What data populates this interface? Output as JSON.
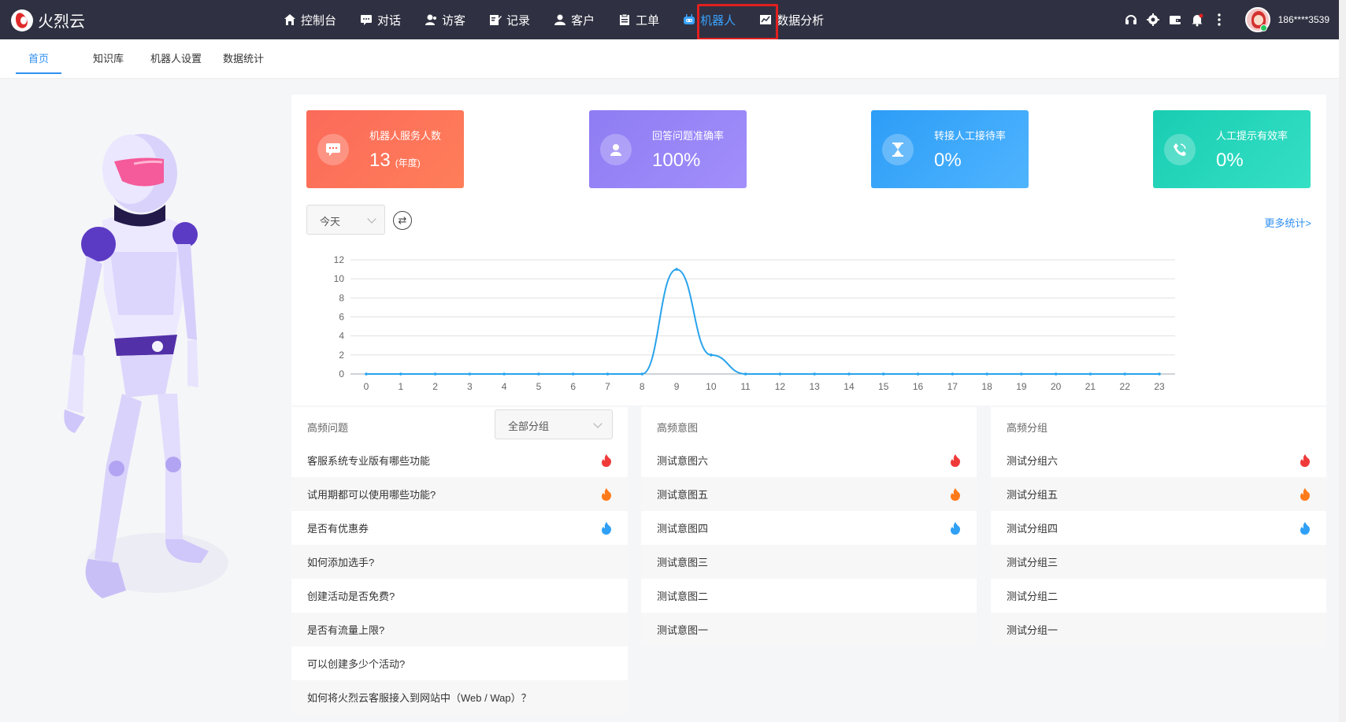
{
  "app": {
    "name": "火烈云"
  },
  "nav": {
    "items": [
      {
        "label": "控制台",
        "icon": "home-icon"
      },
      {
        "label": "对话",
        "icon": "chat-icon"
      },
      {
        "label": "访客",
        "icon": "visitor-icon"
      },
      {
        "label": "记录",
        "icon": "record-icon"
      },
      {
        "label": "客户",
        "icon": "customer-icon"
      },
      {
        "label": "工单",
        "icon": "ticket-icon"
      },
      {
        "label": "机器人",
        "icon": "robot-icon",
        "active": true
      },
      {
        "label": "数据分析",
        "icon": "analytics-icon"
      }
    ]
  },
  "user": {
    "name": "186****3539"
  },
  "subnav": {
    "items": [
      "首页",
      "知识库",
      "机器人设置",
      "数据统计"
    ]
  },
  "cards": [
    {
      "title": "机器人服务人数",
      "value": "13",
      "suffix": "(年度)",
      "color": "#fb6a5a"
    },
    {
      "title": "回答问题准确率",
      "value": "100%",
      "color": "#9584f6"
    },
    {
      "title": "转接人工接待率",
      "value": "0%",
      "color": "#3aa6fa"
    },
    {
      "title": "人工提示有效率",
      "value": "0%",
      "color": "#21d3b9"
    }
  ],
  "filters": {
    "period": "今天",
    "group": "全部分组",
    "more": "更多统计>"
  },
  "chart_data": {
    "type": "line",
    "x": [
      0,
      1,
      2,
      3,
      4,
      5,
      6,
      7,
      8,
      9,
      10,
      11,
      12,
      13,
      14,
      15,
      16,
      17,
      18,
      19,
      20,
      21,
      22,
      23
    ],
    "series": [
      {
        "values": [
          0,
          0,
          0,
          0,
          0,
          0,
          0,
          0,
          0,
          11,
          2,
          0,
          0,
          0,
          0,
          0,
          0,
          0,
          0,
          0,
          0,
          0,
          0,
          0
        ],
        "color": "#29a3ec"
      }
    ],
    "ylim": [
      0,
      12
    ],
    "yticks": [
      0,
      2,
      4,
      6,
      8,
      10,
      12
    ],
    "grid": true
  },
  "lists": {
    "questions": {
      "header": "高频问题",
      "rows": [
        {
          "text": "客服系统专业版有哪些功能",
          "flame": "red"
        },
        {
          "text": "试用期都可以使用哪些功能?",
          "flame": "orange"
        },
        {
          "text": "是否有优惠券",
          "flame": "blue"
        },
        {
          "text": "如何添加选手?"
        },
        {
          "text": "创建活动是否免费?"
        },
        {
          "text": "是否有流量上限?"
        },
        {
          "text": "可以创建多少个活动?"
        },
        {
          "text": "如何将火烈云客服接入到网站中（Web / Wap）？"
        }
      ]
    },
    "intents": {
      "header": "高频意图",
      "rows": [
        {
          "text": "测试意图六",
          "flame": "red"
        },
        {
          "text": "测试意图五",
          "flame": "orange"
        },
        {
          "text": "测试意图四",
          "flame": "blue"
        },
        {
          "text": "测试意图三"
        },
        {
          "text": "测试意图二"
        },
        {
          "text": "测试意图一"
        }
      ]
    },
    "groups": {
      "header": "高频分组",
      "rows": [
        {
          "text": "测试分组六",
          "flame": "red"
        },
        {
          "text": "测试分组五",
          "flame": "orange"
        },
        {
          "text": "测试分组四",
          "flame": "blue"
        },
        {
          "text": "测试分组三"
        },
        {
          "text": "测试分组二"
        },
        {
          "text": "测试分组一"
        }
      ]
    }
  }
}
